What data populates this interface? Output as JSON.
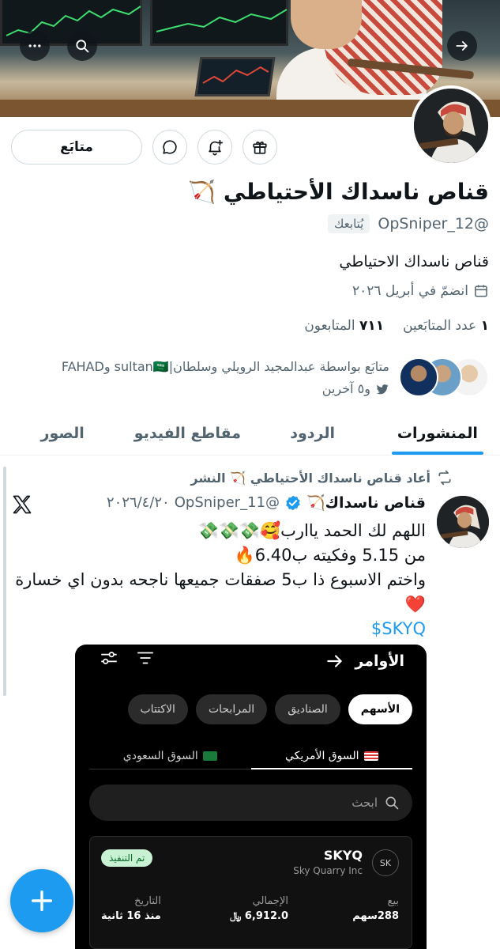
{
  "profile": {
    "follow_label": "متابَع",
    "name": "قناص ناسداك الأحتياطي 🏹",
    "handle": "@OpSniper_12",
    "follows_you": "يُتابعك",
    "bio": "قناص ناسداك الاحتياطي",
    "joined": "انضمّ في أبريل ٢٠٢٦",
    "following_count": "١",
    "following_label": "عدد المتابَعين",
    "followers_count": "٧١١",
    "followers_label": "المتابعون",
    "followed_by_line1": "متابَع بواسطة عبدالمجيد الرويلي وسلطان|sultan🇸🇦 وFAHAD",
    "followed_by_line2": "و٥ آخرين"
  },
  "tabs": [
    {
      "label": "المنشورات",
      "active": true
    },
    {
      "label": "الردود",
      "active": false
    },
    {
      "label": "مقاطع الفيديو",
      "active": false
    },
    {
      "label": "الصور",
      "active": false
    }
  ],
  "post": {
    "repost_label": "أعاد قناص ناسداك الأحتياطي 🏹 النشر",
    "author_name": "قناص ناسداك🏹",
    "author_handle": "@OpSniper_11",
    "date": "٢٠٢٦/٤/٢٠",
    "line1": "اللهم لك الحمد ياارب🥰💸💸💸",
    "line2": "من 5.15 وفكيته ب6.40🔥",
    "line3": "واختم الاسبوع ذا ب5 صفقات جميعها ناجحه بدون اي خسارة ❤️",
    "cashtag": "$SKYQ"
  },
  "trading_app": {
    "orders_title": "الأوامر",
    "chips": [
      {
        "label": "الأسهم",
        "active": true
      },
      {
        "label": "الصناديق",
        "active": false
      },
      {
        "label": "المرابحات",
        "active": false
      },
      {
        "label": "الاكتتاب",
        "active": false
      }
    ],
    "markets": [
      {
        "label": "السوق الأمريكي",
        "active": true
      },
      {
        "label": "السوق السعودي",
        "active": false
      }
    ],
    "search_placeholder": "ابحث",
    "order": {
      "avatar_text": "SK",
      "ticker": "SKYQ",
      "company": "Sky Quarry Inc",
      "status": "تم التنفيذ",
      "side_label": "بيع",
      "side_value": "288سهم",
      "total_label": "الإجمالي",
      "total_value": "6,912.0 ﷼",
      "date_label": "التاريخ",
      "date_value": "منذ 16 ثانية"
    }
  },
  "colors": {
    "accent": "#1d9bf0",
    "text": "#0f1419",
    "muted": "#536471"
  }
}
